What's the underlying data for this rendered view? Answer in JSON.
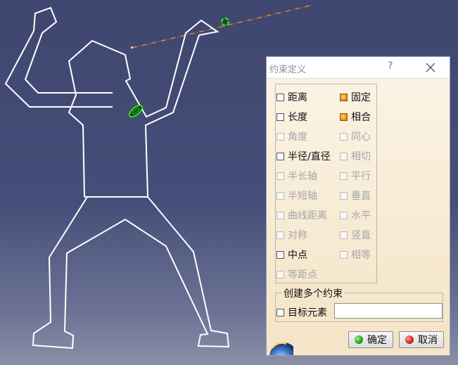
{
  "dialog": {
    "title": "约束定义",
    "help_label": "?",
    "left_column": [
      {
        "label": "距离",
        "state": "enabled"
      },
      {
        "label": "长度",
        "state": "enabled"
      },
      {
        "label": "角度",
        "state": "disabled"
      },
      {
        "label": "半径/直径",
        "state": "enabled"
      },
      {
        "label": "半长轴",
        "state": "disabled"
      },
      {
        "label": "半短轴",
        "state": "disabled"
      },
      {
        "label": "曲线距离",
        "state": "disabled"
      },
      {
        "label": "对称",
        "state": "disabled"
      },
      {
        "label": "中点",
        "state": "enabled"
      },
      {
        "label": "等距点",
        "state": "disabled"
      }
    ],
    "right_column": [
      {
        "label": "固定",
        "state": "checked"
      },
      {
        "label": "相合",
        "state": "checked"
      },
      {
        "label": "同心",
        "state": "disabled"
      },
      {
        "label": "相切",
        "state": "disabled"
      },
      {
        "label": "平行",
        "state": "disabled"
      },
      {
        "label": "垂直",
        "state": "disabled"
      },
      {
        "label": "水平",
        "state": "disabled"
      },
      {
        "label": "竖直",
        "state": "disabled"
      },
      {
        "label": "相等",
        "state": "disabled"
      }
    ],
    "multi_group": {
      "legend": "创建多个约束",
      "target_label": "目标元素",
      "target_value": ""
    },
    "ok_label": "确定",
    "cancel_label": "取消"
  },
  "colors": {
    "sketch_line": "#ffffff",
    "construction_line": "#ff8a2a",
    "highlight_green": "#37e02a",
    "checked_orange": "#f29a1a"
  }
}
